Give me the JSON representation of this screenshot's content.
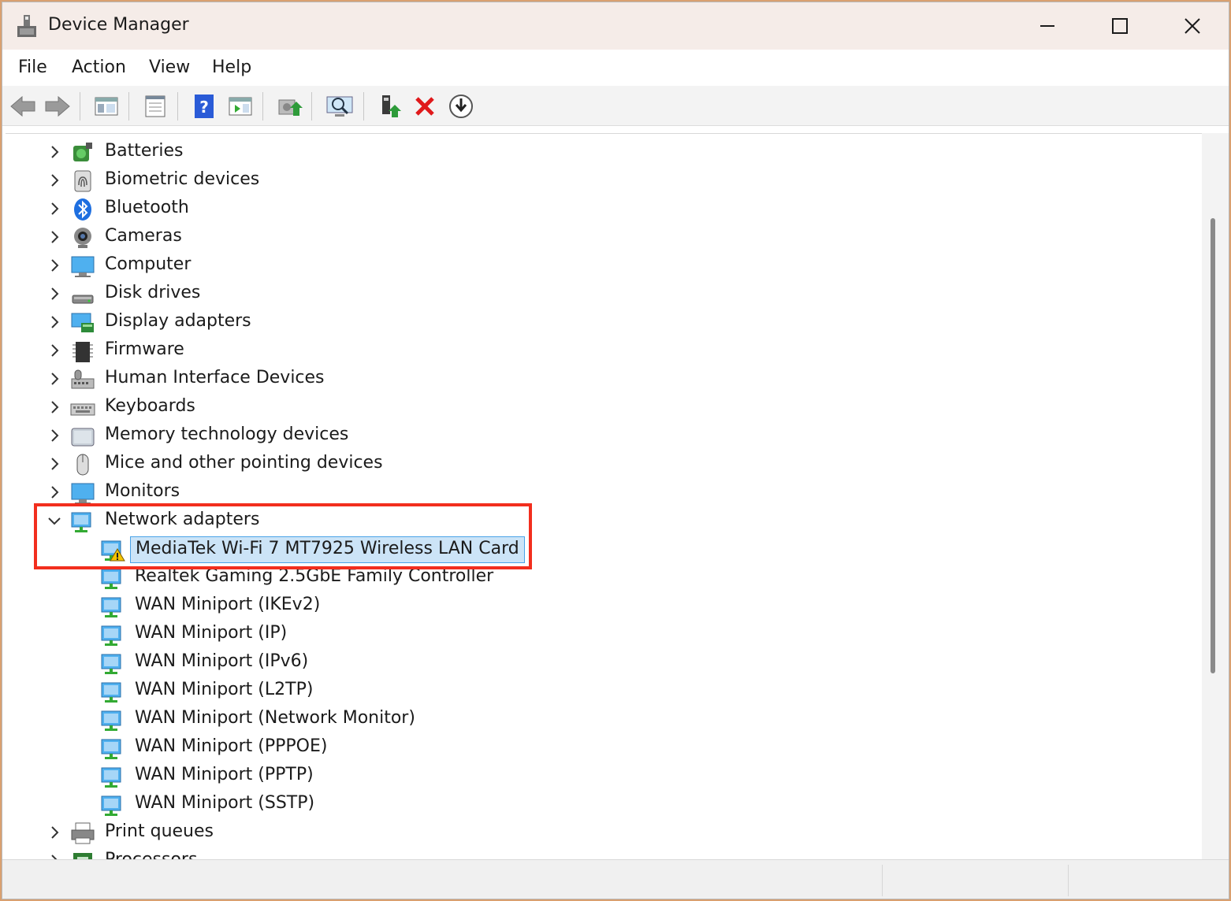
{
  "window": {
    "title": "Device Manager"
  },
  "menu": [
    "File",
    "Action",
    "View",
    "Help"
  ],
  "toolbar": {
    "buttons": [
      "back-icon",
      "forward-icon",
      "show-hide-console-tree-icon",
      "properties-icon",
      "help-icon",
      "action-pane-icon",
      "update-driver-icon",
      "scan-hardware-icon",
      "enable-device-icon",
      "uninstall-device-icon",
      "download-driver-icon"
    ]
  },
  "tree": {
    "categories_top": [
      {
        "label": "Batteries",
        "icon": "battery-icon"
      },
      {
        "label": "Biometric devices",
        "icon": "fingerprint-icon"
      },
      {
        "label": "Bluetooth",
        "icon": "bluetooth-icon"
      },
      {
        "label": "Cameras",
        "icon": "camera-icon"
      },
      {
        "label": "Computer",
        "icon": "computer-icon"
      },
      {
        "label": "Disk drives",
        "icon": "disk-drive-icon"
      },
      {
        "label": "Display adapters",
        "icon": "display-adapter-icon"
      },
      {
        "label": "Firmware",
        "icon": "firmware-icon"
      },
      {
        "label": "Human Interface Devices",
        "icon": "hid-icon"
      },
      {
        "label": "Keyboards",
        "icon": "keyboard-icon"
      },
      {
        "label": "Memory technology devices",
        "icon": "memory-icon"
      },
      {
        "label": "Mice and other pointing devices",
        "icon": "mouse-icon"
      },
      {
        "label": "Monitors",
        "icon": "monitor-icon"
      }
    ],
    "expanded": {
      "label": "Network adapters",
      "icon": "network-adapter-icon",
      "children": [
        {
          "label": "MediaTek Wi-Fi 7 MT7925 Wireless LAN Card",
          "warning": true,
          "selected": true
        },
        {
          "label": "Realtek Gaming 2.5GbE Family Controller"
        },
        {
          "label": "WAN Miniport (IKEv2)"
        },
        {
          "label": "WAN Miniport (IP)"
        },
        {
          "label": "WAN Miniport (IPv6)"
        },
        {
          "label": "WAN Miniport (L2TP)"
        },
        {
          "label": "WAN Miniport (Network Monitor)"
        },
        {
          "label": "WAN Miniport (PPPOE)"
        },
        {
          "label": "WAN Miniport (PPTP)"
        },
        {
          "label": "WAN Miniport (SSTP)"
        }
      ]
    },
    "categories_bottom": [
      {
        "label": "Print queues",
        "icon": "printer-icon"
      },
      {
        "label": "Processors",
        "icon": "processor-icon"
      }
    ]
  },
  "colors": {
    "highlight": "#f22e1e",
    "selection": "#cce4f7",
    "selection_border": "#4aa3e8"
  }
}
